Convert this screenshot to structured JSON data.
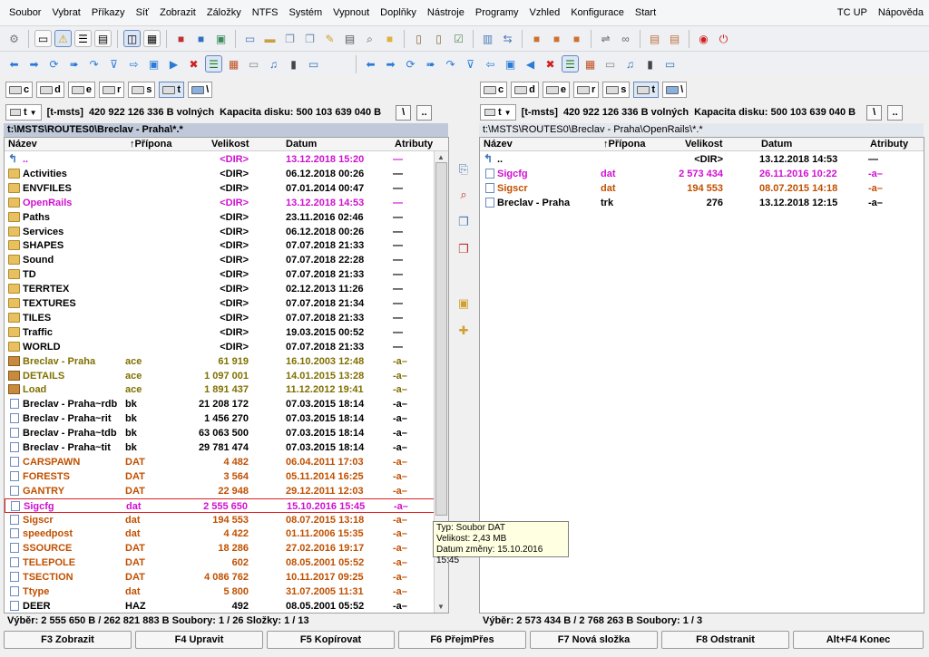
{
  "menu": {
    "left": [
      "Soubor",
      "Vybrat",
      "Příkazy",
      "Síť",
      "Zobrazit",
      "Záložky",
      "NTFS",
      "Systém",
      "Vypnout",
      "Doplňky",
      "Nástroje",
      "Programy",
      "Vzhled",
      "Konfigurace",
      "Start"
    ],
    "right": [
      "TC UP",
      "Nápověda"
    ]
  },
  "drives": [
    "c",
    "d",
    "e",
    "r",
    "s",
    "t",
    "\\"
  ],
  "active_drive": "t",
  "left": {
    "drive_select": "t",
    "volume_label": "[t-msts]",
    "free_text": "420 922 126 336 B volných",
    "capacity_text": "Kapacita disku: 500 103 639 040 B",
    "path": "t:\\MSTS\\ROUTES0\\Breclav - Praha\\*.*",
    "headers": {
      "name": "Název",
      "ext": "↑Přípona",
      "size": "Velikost",
      "date": "Datum",
      "attr": "Atributy"
    },
    "rows": [
      {
        "name": "..",
        "ext": "",
        "size": "<DIR>",
        "date": "13.12.2018 15:20",
        "attr": "—",
        "type": "up",
        "color": "pink"
      },
      {
        "name": "Activities",
        "ext": "",
        "size": "<DIR>",
        "date": "06.12.2018 00:26",
        "attr": "—",
        "type": "folder",
        "color": "dir"
      },
      {
        "name": "ENVFILES",
        "ext": "",
        "size": "<DIR>",
        "date": "07.01.2014 00:47",
        "attr": "—",
        "type": "folder",
        "color": "dir"
      },
      {
        "name": "OpenRails",
        "ext": "",
        "size": "<DIR>",
        "date": "13.12.2018 14:53",
        "attr": "—",
        "type": "folder",
        "color": "pink"
      },
      {
        "name": "Paths",
        "ext": "",
        "size": "<DIR>",
        "date": "23.11.2016 02:46",
        "attr": "—",
        "type": "folder",
        "color": "dir"
      },
      {
        "name": "Services",
        "ext": "",
        "size": "<DIR>",
        "date": "06.12.2018 00:26",
        "attr": "—",
        "type": "folder",
        "color": "dir"
      },
      {
        "name": "SHAPES",
        "ext": "",
        "size": "<DIR>",
        "date": "07.07.2018 21:33",
        "attr": "—",
        "type": "folder",
        "color": "dir"
      },
      {
        "name": "Sound",
        "ext": "",
        "size": "<DIR>",
        "date": "07.07.2018 22:28",
        "attr": "—",
        "type": "folder",
        "color": "dir"
      },
      {
        "name": "TD",
        "ext": "",
        "size": "<DIR>",
        "date": "07.07.2018 21:33",
        "attr": "—",
        "type": "folder",
        "color": "dir"
      },
      {
        "name": "TERRTEX",
        "ext": "",
        "size": "<DIR>",
        "date": "02.12.2013 11:26",
        "attr": "—",
        "type": "folder",
        "color": "dir"
      },
      {
        "name": "TEXTURES",
        "ext": "",
        "size": "<DIR>",
        "date": "07.07.2018 21:34",
        "attr": "—",
        "type": "folder",
        "color": "dir"
      },
      {
        "name": "TILES",
        "ext": "",
        "size": "<DIR>",
        "date": "07.07.2018 21:33",
        "attr": "—",
        "type": "folder",
        "color": "dir"
      },
      {
        "name": "Traffic",
        "ext": "",
        "size": "<DIR>",
        "date": "19.03.2015 00:52",
        "attr": "—",
        "type": "folder",
        "color": "dir"
      },
      {
        "name": "WORLD",
        "ext": "",
        "size": "<DIR>",
        "date": "07.07.2018 21:33",
        "attr": "—",
        "type": "folder",
        "color": "dir"
      },
      {
        "name": "Breclav - Praha",
        "ext": "ace",
        "size": "61 919",
        "date": "16.10.2003 12:48",
        "attr": "-a–",
        "type": "arc",
        "color": "olive"
      },
      {
        "name": "DETAILS",
        "ext": "ace",
        "size": "1 097 001",
        "date": "14.01.2015 13:28",
        "attr": "-a–",
        "type": "arc",
        "color": "olive"
      },
      {
        "name": "Load",
        "ext": "ace",
        "size": "1 891 437",
        "date": "11.12.2012 19:41",
        "attr": "-a–",
        "type": "arc",
        "color": "olive"
      },
      {
        "name": "Breclav - Praha~rdb",
        "ext": "bk",
        "size": "21 208 172",
        "date": "07.03.2015 18:14",
        "attr": "-a–",
        "type": "file",
        "color": "black"
      },
      {
        "name": "Breclav - Praha~rit",
        "ext": "bk",
        "size": "1 456 270",
        "date": "07.03.2015 18:14",
        "attr": "-a–",
        "type": "file",
        "color": "black"
      },
      {
        "name": "Breclav - Praha~tdb",
        "ext": "bk",
        "size": "63 063 500",
        "date": "07.03.2015 18:14",
        "attr": "-a–",
        "type": "file",
        "color": "black"
      },
      {
        "name": "Breclav - Praha~tit",
        "ext": "bk",
        "size": "29 781 474",
        "date": "07.03.2015 18:14",
        "attr": "-a–",
        "type": "file",
        "color": "black"
      },
      {
        "name": "CARSPAWN",
        "ext": "DAT",
        "size": "4 482",
        "date": "06.04.2011 17:03",
        "attr": "-a–",
        "type": "file",
        "color": "orange"
      },
      {
        "name": "FORESTS",
        "ext": "DAT",
        "size": "3 564",
        "date": "05.11.2014 16:25",
        "attr": "-a–",
        "type": "file",
        "color": "orange"
      },
      {
        "name": "GANTRY",
        "ext": "DAT",
        "size": "22 948",
        "date": "29.12.2011 12:03",
        "attr": "-a–",
        "type": "file",
        "color": "orange"
      },
      {
        "name": "Sigcfg",
        "ext": "dat",
        "size": "2 555 650",
        "date": "15.10.2016 15:45",
        "attr": "-a–",
        "type": "file",
        "color": "pink",
        "selected": true
      },
      {
        "name": "Sigscr",
        "ext": "dat",
        "size": "194 553",
        "date": "08.07.2015 13:18",
        "attr": "-a–",
        "type": "file",
        "color": "orange"
      },
      {
        "name": "speedpost",
        "ext": "dat",
        "size": "4 422",
        "date": "01.11.2006 15:35",
        "attr": "-a–",
        "type": "file",
        "color": "orange"
      },
      {
        "name": "SSOURCE",
        "ext": "DAT",
        "size": "18 286",
        "date": "27.02.2016 19:17",
        "attr": "-a–",
        "type": "file",
        "color": "orange"
      },
      {
        "name": "TELEPOLE",
        "ext": "DAT",
        "size": "602",
        "date": "08.05.2001 05:52",
        "attr": "-a–",
        "type": "file",
        "color": "orange"
      },
      {
        "name": "TSECTION",
        "ext": "DAT",
        "size": "4 086 762",
        "date": "10.11.2017 09:25",
        "attr": "-a–",
        "type": "file",
        "color": "orange"
      },
      {
        "name": "Ttype",
        "ext": "dat",
        "size": "5 800",
        "date": "31.07.2005 11:31",
        "attr": "-a–",
        "type": "file",
        "color": "orange"
      },
      {
        "name": "DEER",
        "ext": "HAZ",
        "size": "492",
        "date": "08.05.2001 05:52",
        "attr": "-a–",
        "type": "file",
        "color": "black"
      }
    ],
    "status": "Výběr: 2 555 650 B / 262 821 883 B  Soubory: 1 / 26  Složky: 1 / 13"
  },
  "right": {
    "drive_select": "t",
    "volume_label": "[t-msts]",
    "free_text": "420 922 126 336 B volných",
    "capacity_text": "Kapacita disku: 500 103 639 040 B",
    "path": "t:\\MSTS\\ROUTES0\\Breclav - Praha\\OpenRails\\*.*",
    "headers": {
      "name": "Název",
      "ext": "↑Přípona",
      "size": "Velikost",
      "date": "Datum",
      "attr": "Atributy"
    },
    "rows": [
      {
        "name": "..",
        "ext": "",
        "size": "<DIR>",
        "date": "13.12.2018 14:53",
        "attr": "—",
        "type": "up",
        "color": "dir"
      },
      {
        "name": "Sigcfg",
        "ext": "dat",
        "size": "2 573 434",
        "date": "26.11.2016 10:22",
        "attr": "-a–",
        "type": "file",
        "color": "pink"
      },
      {
        "name": "Sigscr",
        "ext": "dat",
        "size": "194 553",
        "date": "08.07.2015 14:18",
        "attr": "-a–",
        "type": "file",
        "color": "orange"
      },
      {
        "name": "Breclav - Praha",
        "ext": "trk",
        "size": "276",
        "date": "13.12.2018 12:15",
        "attr": "-a–",
        "type": "file",
        "color": "black"
      }
    ],
    "status": "Výběr: 2 573 434 B / 2 768 263 B  Soubory: 1 / 3"
  },
  "tooltip": {
    "line1": "Typ: Soubor DAT",
    "line2": "Velikost: 2,43 MB",
    "line3": "Datum změny: 15.10.2016 15:45"
  },
  "fkeys": [
    "F3 Zobrazit",
    "F4 Upravit",
    "F5 Kopírovat",
    "F6 PřejmPřes",
    "F7 Nová složka",
    "F8 Odstranit",
    "Alt+F4 Konec"
  ],
  "colors": {
    "dir": "#000000",
    "pink": "#d010d0",
    "olive": "#807000",
    "orange": "#c05000",
    "black": "#000000",
    "path_bar": "#bfc9d9"
  }
}
